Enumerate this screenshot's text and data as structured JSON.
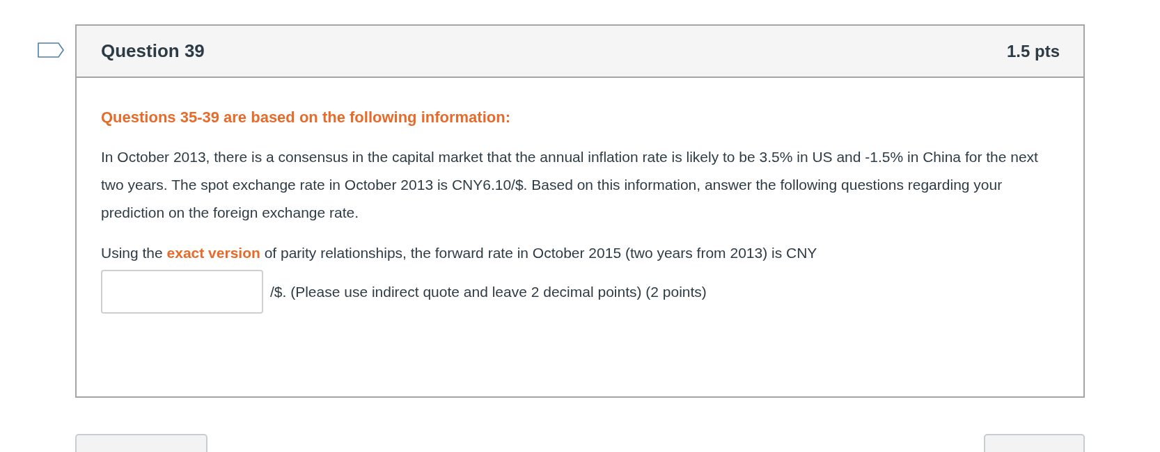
{
  "question": {
    "title": "Question 39",
    "points": "1.5 pts",
    "flagged": false
  },
  "intro_heading": "Questions 35-39 are based on the following information:",
  "paragraphs": [
    "In October 2013, there is a consensus in the capital market that the annual inflation rate is likely to be 3.5% in US and -1.5% in China for the next two years. The spot exchange rate in October 2013 is CNY6.10/$. Based on this information, answer the following questions regarding your prediction on the foreign exchange rate."
  ],
  "prompt": {
    "before": "Using the ",
    "highlight": "exact version",
    "after": " of parity relationships, the forward rate in October 2015 (two years from 2013) is CNY",
    "after_field": "/$. (Please use indirect quote and leave 2 decimal points) (2 points)"
  }
}
